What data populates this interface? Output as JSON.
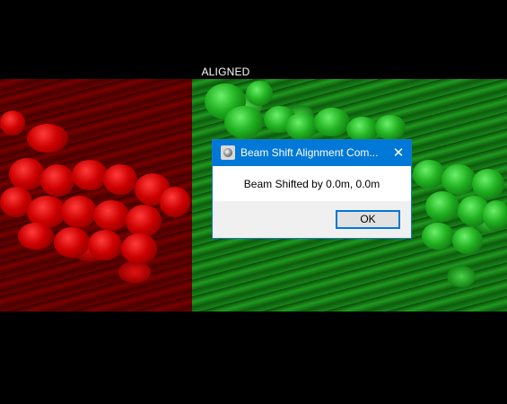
{
  "status_label": "ALIGNED",
  "dialog": {
    "title": "Beam Shift Alignment Com...",
    "close_glyph": "✕",
    "message": "Beam Shifted by 0.0m, 0.0m",
    "ok_label": "OK"
  },
  "colors": {
    "titlebar": "#0078d7",
    "red_channel": "#cc0000",
    "green_channel": "#20b020"
  },
  "icons": {
    "app_icon": "beam-alignment-app-icon",
    "close_icon": "close-icon"
  }
}
